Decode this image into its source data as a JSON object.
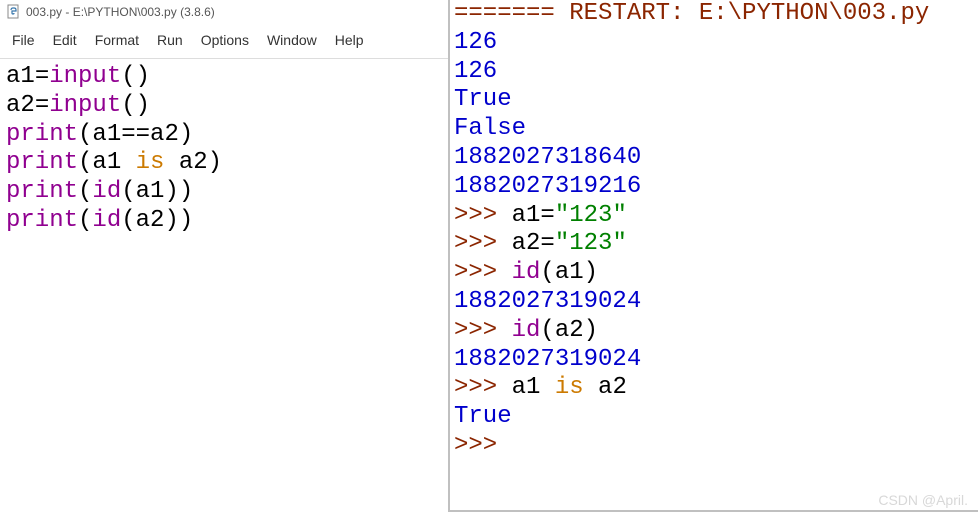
{
  "editor": {
    "title": "003.py - E:\\PYTHON\\003.py (3.8.6)",
    "menu": [
      "File",
      "Edit",
      "Format",
      "Run",
      "Options",
      "Window",
      "Help"
    ],
    "code": {
      "l1_a1": "a1",
      "l1_eq": "=",
      "l1_input": "input",
      "l1_par": "()",
      "l2_a2": "a2",
      "l2_eq": "=",
      "l2_input": "input",
      "l2_par": "()",
      "l3_print": "print",
      "l3_open": "(",
      "l3_expr_a1": "a1",
      "l3_expr_eq": "==",
      "l3_expr_a2": "a2",
      "l3_close": ")",
      "l4_print": "print",
      "l4_open": "(",
      "l4_a1": "a1 ",
      "l4_is": "is",
      "l4_a2": " a2",
      "l4_close": ")",
      "l5_print": "print",
      "l5_open": "(",
      "l5_id": "id",
      "l5_open2": "(",
      "l5_a1": "a1",
      "l5_close2": ")",
      "l5_close": ")",
      "l6_print": "print",
      "l6_open": "(",
      "l6_id": "id",
      "l6_open2": "(",
      "l6_a2": "a2",
      "l6_close2": ")",
      "l6_close": ")"
    }
  },
  "shell": {
    "restart_eq": "=======",
    "restart_text": " RESTART: E:\\PYTHON\\003.py",
    "out1": "126",
    "out2": "126",
    "out3": "True",
    "out4": "False",
    "out5": "1882027318640",
    "out6": "1882027319216",
    "prompt": ">>> ",
    "p1_a1": "a1",
    "p1_eq": "=",
    "p1_str": "\"123\"",
    "p2_a2": "a2",
    "p2_eq": "=",
    "p2_str": "\"123\"",
    "p3_id": "id",
    "p3_open": "(",
    "p3_a1": "a1",
    "p3_close": ")",
    "r3": "1882027319024",
    "p4_id": "id",
    "p4_open": "(",
    "p4_a2": "a2",
    "p4_close": ")",
    "r4": "1882027319024",
    "p5_a1": "a1 ",
    "p5_is": "is",
    "p5_a2": " a2",
    "r5": "True"
  },
  "watermark": "CSDN @April.​"
}
